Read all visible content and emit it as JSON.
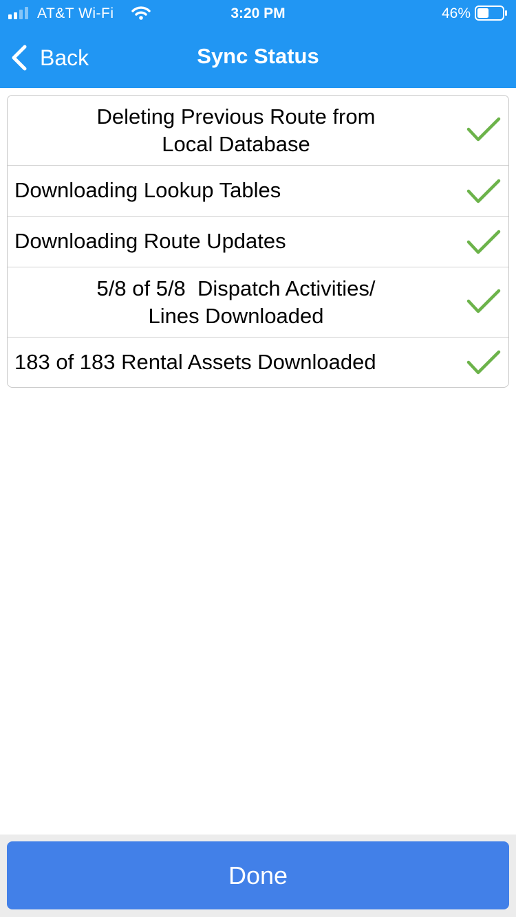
{
  "status_bar": {
    "carrier": "AT&T Wi-Fi",
    "time": "3:20 PM",
    "battery": "46%",
    "battery_level": 0.46
  },
  "nav": {
    "back_label": "Back",
    "title": "Sync Status"
  },
  "sync_steps": [
    {
      "line1": "Deleting Previous Route from",
      "line2": "Local Database",
      "done": true
    },
    {
      "text": "Downloading Lookup Tables",
      "done": true
    },
    {
      "text": "Downloading Route Updates",
      "done": true
    },
    {
      "line1": "5/8 of 5/8  Dispatch Activities/",
      "line2": "Lines Downloaded",
      "done": true
    },
    {
      "text": "183 of 183 Rental Assets Downloaded",
      "done": true
    }
  ],
  "footer": {
    "done_label": "Done"
  },
  "icons": {
    "check": "checkmark-icon",
    "back": "chevron-left-icon"
  },
  "colors": {
    "header": "#2196f3",
    "check": "#6cb34a",
    "done_button": "#4280e8"
  }
}
